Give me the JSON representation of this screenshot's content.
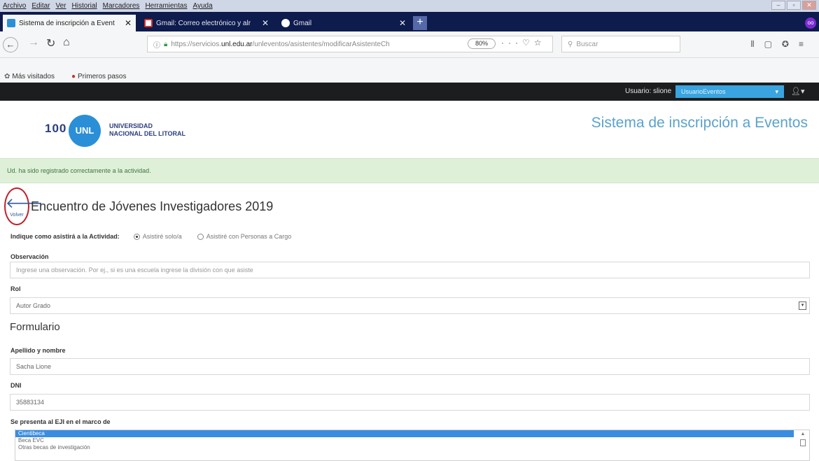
{
  "browser": {
    "menu": [
      "Archivo",
      "Editar",
      "Ver",
      "Historial",
      "Marcadores",
      "Herramientas",
      "Ayuda"
    ],
    "tabs": [
      {
        "title": "Sistema de inscripción a Event",
        "active": true
      },
      {
        "title": "Gmail: Correo electrónico y alr",
        "active": false
      },
      {
        "title": "Gmail",
        "active": false
      }
    ],
    "url_prefix": "https://servicios.",
    "url_domain": "unl.edu.ar",
    "url_path": "/unleventos/asistentes/modificarAsistenteCh",
    "zoom": "80%",
    "search_placeholder": "Buscar",
    "bookmarks": [
      "Más visitados",
      "Primeros pasos"
    ],
    "profile_badge": "oo",
    "accent_color": "#0d1b4d"
  },
  "site": {
    "user_label": "Usuario: slione",
    "role_select": "UsuarioEventos",
    "logo_number": "100",
    "logo_circle": "UNL",
    "logo_line1": "UNIVERSIDAD",
    "logo_line2": "NACIONAL DEL LITORAL",
    "system_title": "Sistema de inscripción a Eventos"
  },
  "alert": {
    "text": "Ud. ha sido registrado correctamente a la actividad.",
    "color": "#dff0d8"
  },
  "main": {
    "back_label": "Volver",
    "event_title": "Encuentro de Jóvenes Investigadores 2019",
    "attendance_question": "Indique como asistirá a la Actividad:",
    "attendance_options": [
      {
        "label": "Asistiré solo/a",
        "selected": true
      },
      {
        "label": "Asistiré con Personas a Cargo",
        "selected": false
      }
    ],
    "observacion_label": "Observación",
    "observacion_placeholder": "Ingrese una observación. Por ej., si es una escuela ingrese la división con que asiste",
    "rol_label": "Rol",
    "rol_value": "Autor Grado",
    "form_heading": "Formulario",
    "name_label": "Apellido y nombre",
    "name_value": "Sacha Lione",
    "dni_label": "DNI",
    "dni_value": "35883134",
    "framework_label": "Se presenta al EJI en el marco de",
    "framework_options": [
      {
        "label": "Cientibeca",
        "selected": true
      },
      {
        "label": "Beca EVC",
        "selected": false
      },
      {
        "label": "Otras becas de investigación",
        "selected": false
      }
    ]
  }
}
